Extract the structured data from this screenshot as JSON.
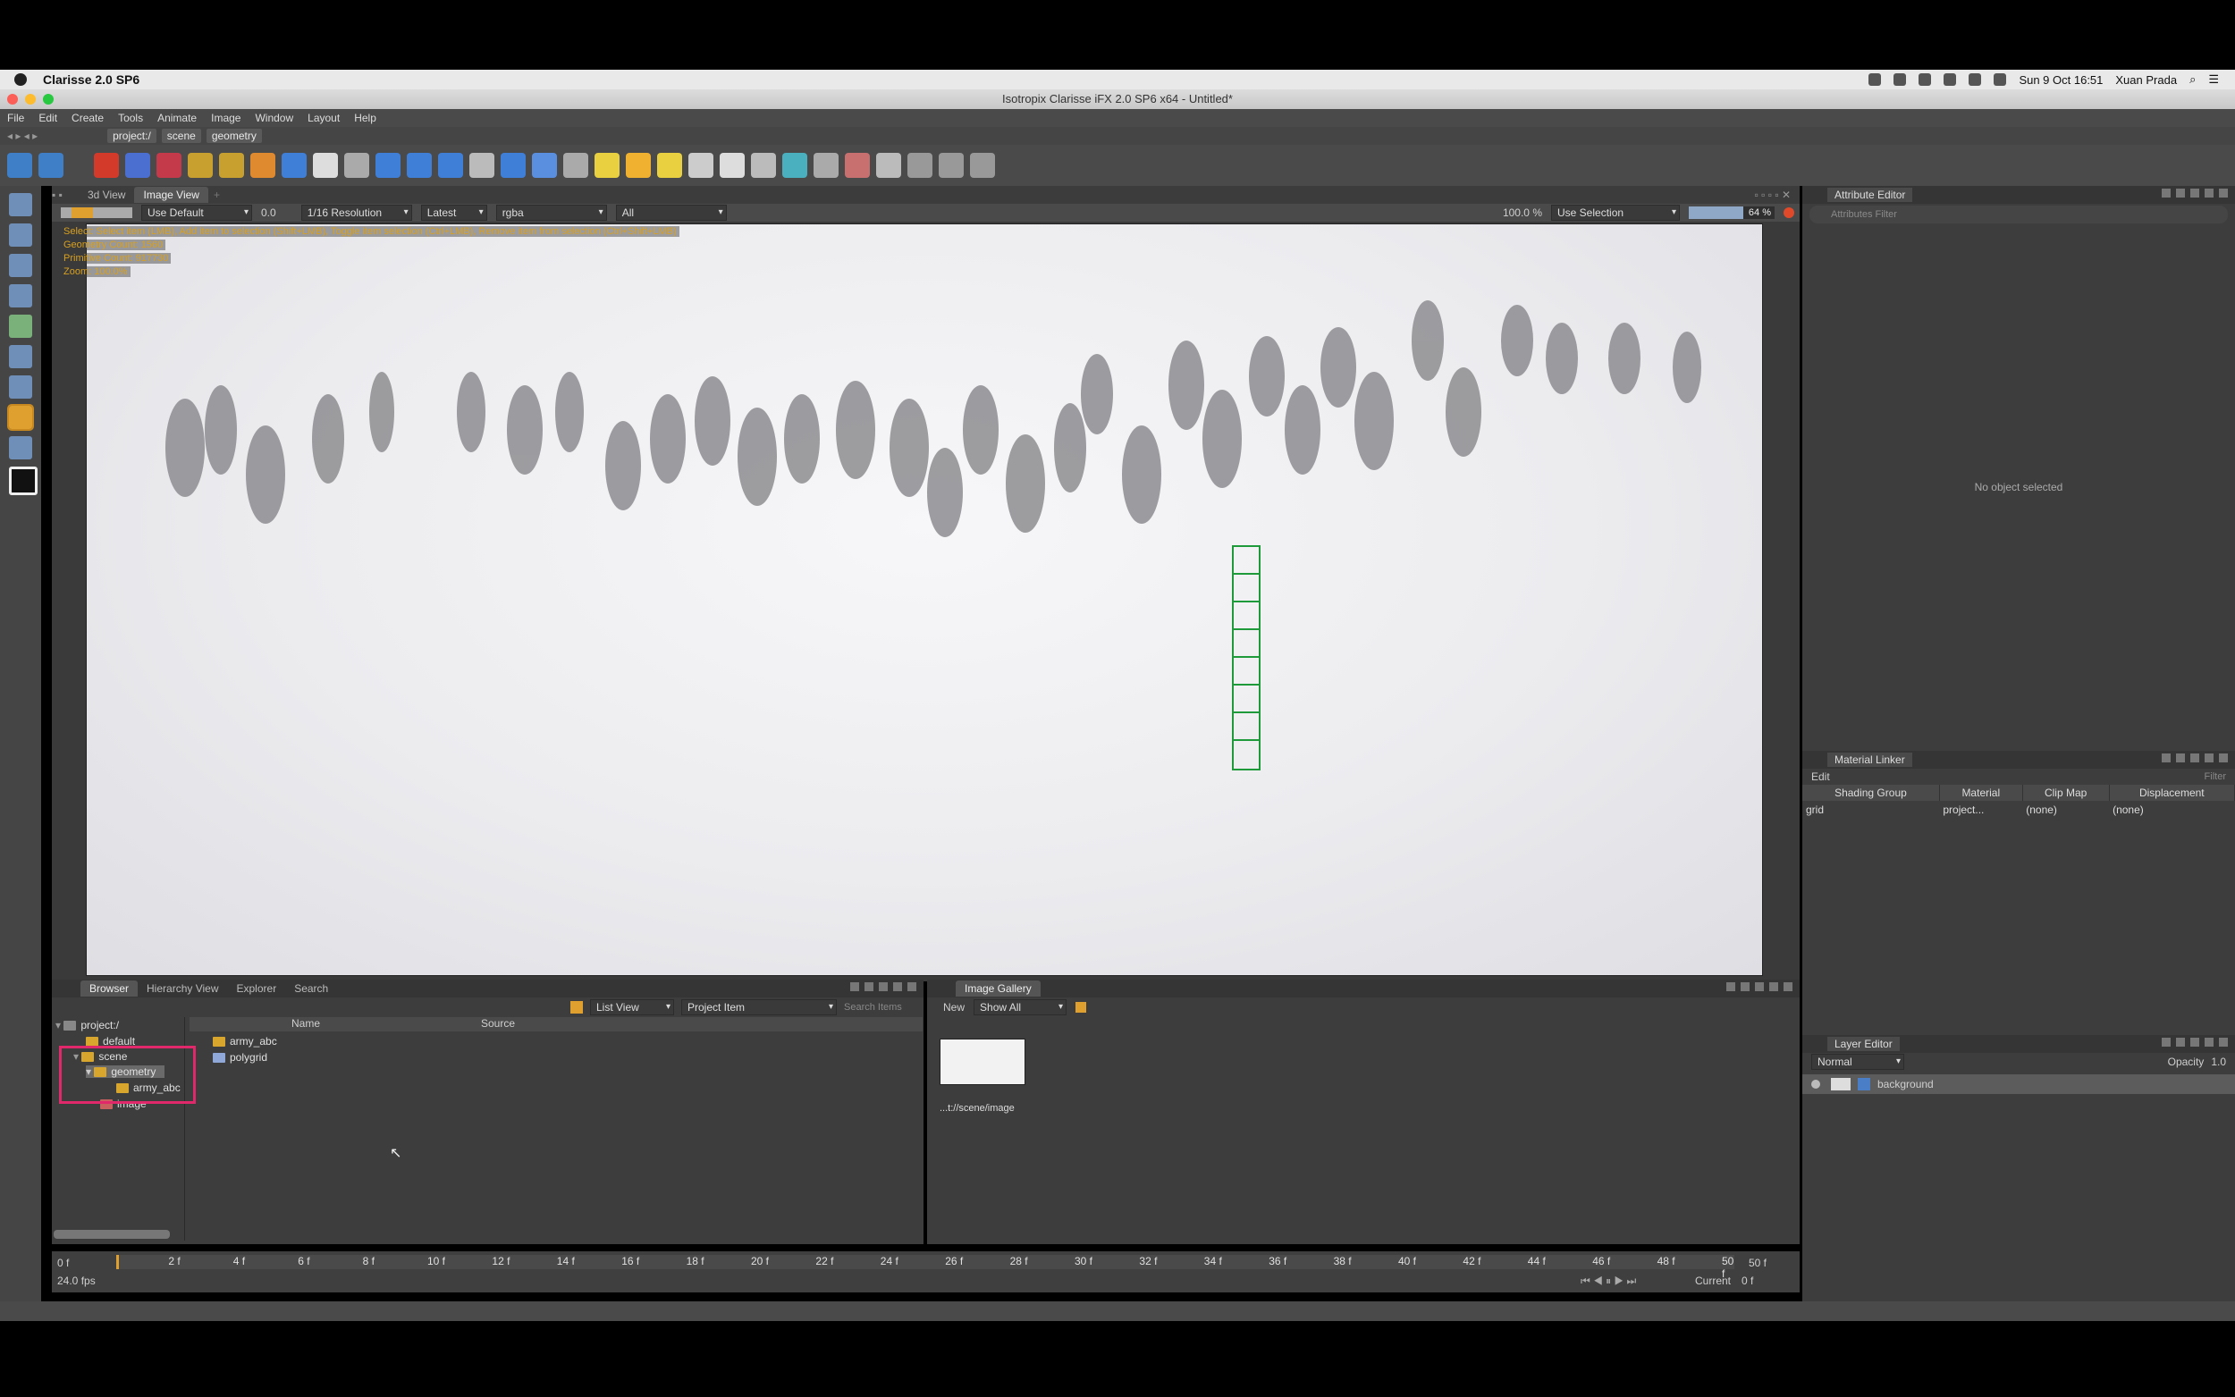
{
  "macmenu": {
    "app": "Clarisse 2.0 SP6",
    "datetime": "Sun 9 Oct  16:51",
    "user": "Xuan Prada"
  },
  "window": {
    "title": "Isotropix Clarisse iFX 2.0 SP6 x64 - Untitled*"
  },
  "menu": [
    "File",
    "Edit",
    "Create",
    "Tools",
    "Animate",
    "Image",
    "Window",
    "Layout",
    "Help"
  ],
  "path": [
    "project:/",
    "scene",
    "geometry"
  ],
  "viewport": {
    "tabs": [
      "3d View",
      "Image View"
    ],
    "display": "Use Default",
    "exposure": "0.0",
    "resolution": "1/16 Resolution",
    "version": "Latest",
    "channel": "rgba",
    "filter": "All",
    "zoom": "100.0 %",
    "mode": "Use Selection",
    "progress_label": "64 %",
    "progress": 0.64,
    "overlay": [
      "Select: Select item (LMB), Add item to selection (Shift+LMB), Toggle item selection (Ctrl+LMB), Remove item from selection (Ctrl+Shift+LMB)",
      "Geometry Count: 1560",
      "Primitive Count: 917730",
      "Zoom: 100.0%"
    ]
  },
  "attribute_editor": {
    "title": "Attribute Editor",
    "filter_placeholder": "Attributes Filter",
    "empty": "No object selected"
  },
  "material_linker": {
    "title": "Material Linker",
    "edit": "Edit",
    "filter_placeholder": "Filter",
    "columns": [
      "Shading Group",
      "Material",
      "Clip Map",
      "Displacement"
    ],
    "rows": [
      {
        "group": "grid",
        "material": "project...",
        "clip": "(none)",
        "disp": "(none)"
      }
    ]
  },
  "layer_editor": {
    "title": "Layer Editor",
    "blend": "Normal",
    "opacity_label": "Opacity",
    "opacity": "1.0",
    "layers": [
      "background"
    ]
  },
  "browser": {
    "tabs": [
      "Browser",
      "Hierarchy View",
      "Explorer",
      "Search"
    ],
    "view": "List View",
    "type": "Project Item",
    "search_placeholder": "Search Items",
    "tree": [
      "project:/",
      "default",
      "scene",
      "geometry",
      "army_abc",
      "image"
    ],
    "columns": [
      "Name",
      "Source"
    ],
    "items": [
      "army_abc",
      "polygrid"
    ]
  },
  "gallery": {
    "title": "Image Gallery",
    "new": "New",
    "show": "Show All",
    "item_label": "...t://scene/image"
  },
  "timeline": {
    "start": "0 f",
    "end": "50 f",
    "fps": "24.0 fps",
    "current_label": "Current",
    "current": "0 f",
    "ticks": [
      "0 f",
      "2 f",
      "4 f",
      "6 f",
      "8 f",
      "10 f",
      "12 f",
      "14 f",
      "16 f",
      "18 f",
      "20 f",
      "22 f",
      "24 f",
      "26 f",
      "28 f",
      "30 f",
      "32 f",
      "34 f",
      "36 f",
      "38 f",
      "40 f",
      "42 f",
      "44 f",
      "46 f",
      "48 f",
      "50 f"
    ]
  }
}
